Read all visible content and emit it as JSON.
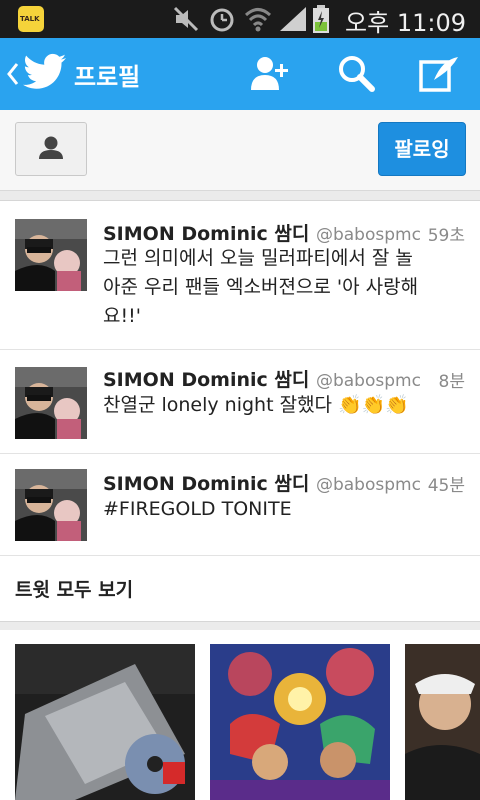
{
  "statusbar": {
    "kakao_label": "TALK",
    "ampm": "오후",
    "time": "11:09"
  },
  "actionbar": {
    "title": "프로필",
    "add_user_icon": "add-user-icon",
    "search_icon": "search-icon",
    "compose_icon": "compose-icon"
  },
  "profile": {
    "follow_label": "팔로잉"
  },
  "tweets": [
    {
      "name": "SIMON Dominic 쌈디",
      "handle": "@babospmc",
      "time": "59초",
      "text": "그런 의미에서 오늘 밀러파티에서 잘 놀아준 우리 팬들 엑소버젼으로 '아 사랑해요!!'"
    },
    {
      "name": "SIMON Dominic 쌈디",
      "handle": "@babospmc",
      "time": "8분",
      "text": "찬열군 lonely night 잘했다 👏👏👏"
    },
    {
      "name": "SIMON Dominic 쌈디",
      "handle": "@babospmc",
      "time": "45분",
      "text": "#FIREGOLD TONITE"
    }
  ],
  "see_all_label": "트윗 모두 보기",
  "colors": {
    "accent": "#2aa3ef",
    "follow": "#1e8fe0"
  }
}
